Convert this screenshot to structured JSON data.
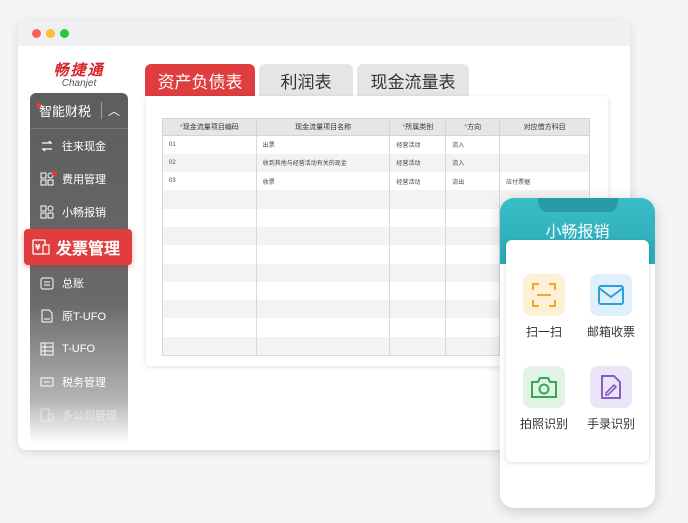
{
  "brand": {
    "name_cn": "畅捷通",
    "name_en": "Chanjet",
    "accent": "#e03d3f",
    "teal": "#2fb1bd"
  },
  "sidebar": {
    "header": "智能财税",
    "items": [
      {
        "label": "往来现金",
        "icon": "exchange-icon"
      },
      {
        "label": "费用管理",
        "icon": "grid-icon",
        "badge": true
      },
      {
        "label": "小畅报销",
        "icon": "grid-icon"
      },
      {
        "label": "发票管理",
        "icon": "invoice-icon",
        "active": true
      },
      {
        "label": "总账",
        "icon": "ledger-icon"
      },
      {
        "label": "原T-UFO",
        "icon": "ufo-file-icon"
      },
      {
        "label": "T-UFO",
        "icon": "report-icon"
      },
      {
        "label": "税务管理",
        "icon": "tax-icon"
      },
      {
        "label": "多公司管理",
        "icon": "company-icon"
      }
    ]
  },
  "tabs": [
    {
      "label": "资产负债表",
      "active": true
    },
    {
      "label": "利润表"
    },
    {
      "label": "现金流量表"
    }
  ],
  "table": {
    "columns": [
      {
        "label": "现金流量项目编码",
        "required": true
      },
      {
        "label": "现金流量项目名称",
        "required": false
      },
      {
        "label": "所属类别",
        "required": true
      },
      {
        "label": "方向",
        "required": true
      },
      {
        "label": "对应借方科目",
        "required": false
      }
    ],
    "rows": [
      [
        "01",
        "出票",
        "经营活动",
        "流入",
        ""
      ],
      [
        "02",
        "收到其他与经营活动有关的现金",
        "经营活动",
        "流入",
        ""
      ],
      [
        "03",
        "收票",
        "经营活动",
        "流出",
        "应付票据"
      ],
      [
        "",
        "",
        "",
        "",
        ""
      ],
      [
        "",
        "",
        "",
        "",
        ""
      ],
      [
        "",
        "",
        "",
        "",
        ""
      ],
      [
        "",
        "",
        "",
        "",
        ""
      ],
      [
        "",
        "",
        "",
        "",
        ""
      ],
      [
        "",
        "",
        "",
        "",
        ""
      ],
      [
        "",
        "",
        "",
        "",
        ""
      ],
      [
        "",
        "",
        "",
        "",
        ""
      ],
      [
        "",
        "",
        "",
        "",
        ""
      ]
    ]
  },
  "phone": {
    "title": "小畅报销",
    "features": [
      {
        "label": "扫一扫",
        "icon": "scan-icon",
        "color": "#f5a623"
      },
      {
        "label": "邮箱收票",
        "icon": "mail-icon",
        "color": "#2f9fd8"
      },
      {
        "label": "拍照识别",
        "icon": "camera-icon",
        "color": "#3aa655"
      },
      {
        "label": "手录识别",
        "icon": "edit-doc-icon",
        "color": "#8a5cc7"
      }
    ]
  }
}
